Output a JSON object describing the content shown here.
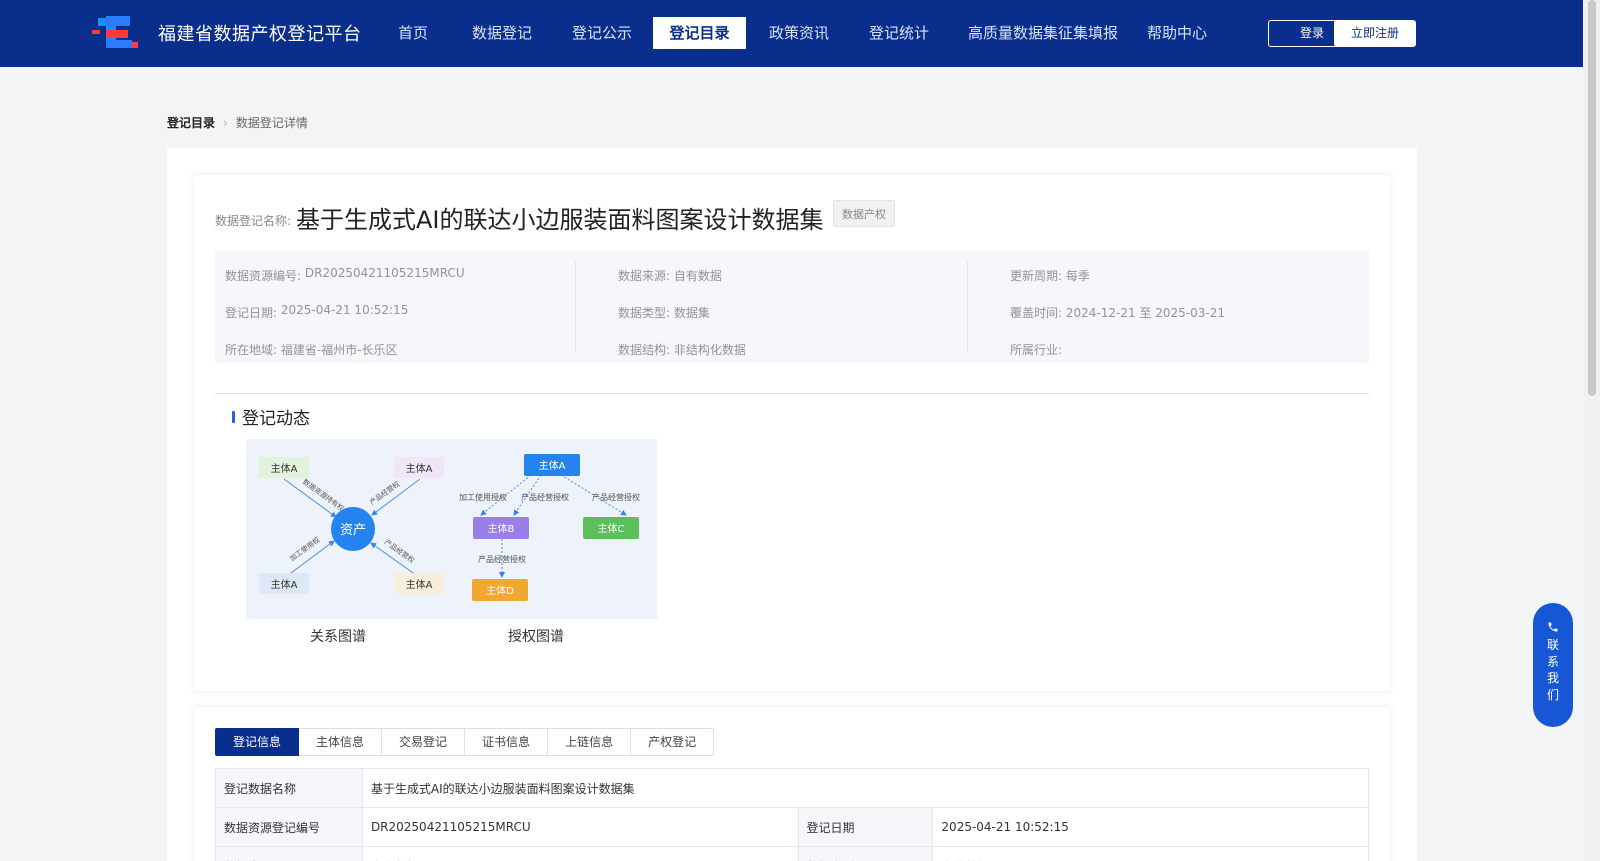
{
  "header": {
    "site_title": "福建省数据产权登记平台",
    "nav": [
      "首页",
      "数据登记",
      "登记公示",
      "登记目录",
      "政策资讯",
      "登记统计",
      "高质量数据集征集填报",
      "帮助中心"
    ],
    "active_nav": "登记目录",
    "login_label": "登录",
    "register_label": "立即注册"
  },
  "breadcrumb": {
    "root": "登记目录",
    "current": "数据登记详情"
  },
  "detail": {
    "name_label": "数据登记名称:",
    "name": "基于生成式AI的联达小边服装面料图案设计数据集",
    "badge": "数据产权",
    "info": {
      "col1": [
        {
          "k": "数据资源编号:",
          "v": "DR20250421105215MRCU"
        },
        {
          "k": "登记日期:",
          "v": "2025-04-21 10:52:15"
        },
        {
          "k": "所在地域:",
          "v": "福建省-福州市-长乐区"
        }
      ],
      "col2": [
        {
          "k": "数据来源:",
          "v": "自有数据"
        },
        {
          "k": "数据类型:",
          "v": "数据集"
        },
        {
          "k": "数据结构:",
          "v": "非结构化数据"
        }
      ],
      "col3": [
        {
          "k": "更新周期:",
          "v": "每季"
        },
        {
          "k": "覆盖时间:",
          "v": "2024-12-21 至 2025-03-21"
        },
        {
          "k": "所属行业:",
          "v": ""
        }
      ]
    }
  },
  "dynamics": {
    "title": "登记动态",
    "relation_caption": "关系图谱",
    "auth_caption": "授权图谱",
    "relation": {
      "center": "资产",
      "nodes": [
        "主体A",
        "主体A",
        "主体A",
        "主体A"
      ],
      "edges": [
        "数据资源持有权",
        "产品经营权",
        "加工使用权",
        "产品经营权"
      ]
    },
    "auth": {
      "nodes": [
        "主体A",
        "主体B",
        "主体C",
        "主体D"
      ],
      "edges": [
        "加工使用授权",
        "产品经营授权",
        "产品经营授权",
        "产品经营授权"
      ]
    }
  },
  "tabs": [
    "登记信息",
    "主体信息",
    "交易登记",
    "证书信息",
    "上链信息",
    "产权登记"
  ],
  "active_tab": "登记信息",
  "table": {
    "r1_k": "登记数据名称",
    "r1_v": "基于生成式AI的联达小边服装面料图案设计数据集",
    "r2_k1": "数据资源登记编号",
    "r2_v1": "DR20250421105215MRCU",
    "r2_k2": "登记日期",
    "r2_v2": "2025-04-21 10:52:15",
    "r3_k1": "数据来源",
    "r3_v1": "自有数据",
    "r3_k2": "数据类型",
    "r3_v2": "企业数据"
  },
  "contact_label": [
    "联",
    "系",
    "我",
    "们"
  ],
  "icons": {
    "logo": "platform-logo-icon",
    "phone": "phone-icon",
    "breadcrumb_sep": "chevron-right-icon"
  },
  "colors": {
    "header_bg": "#0a2e8c",
    "accent": "#1757d6"
  }
}
